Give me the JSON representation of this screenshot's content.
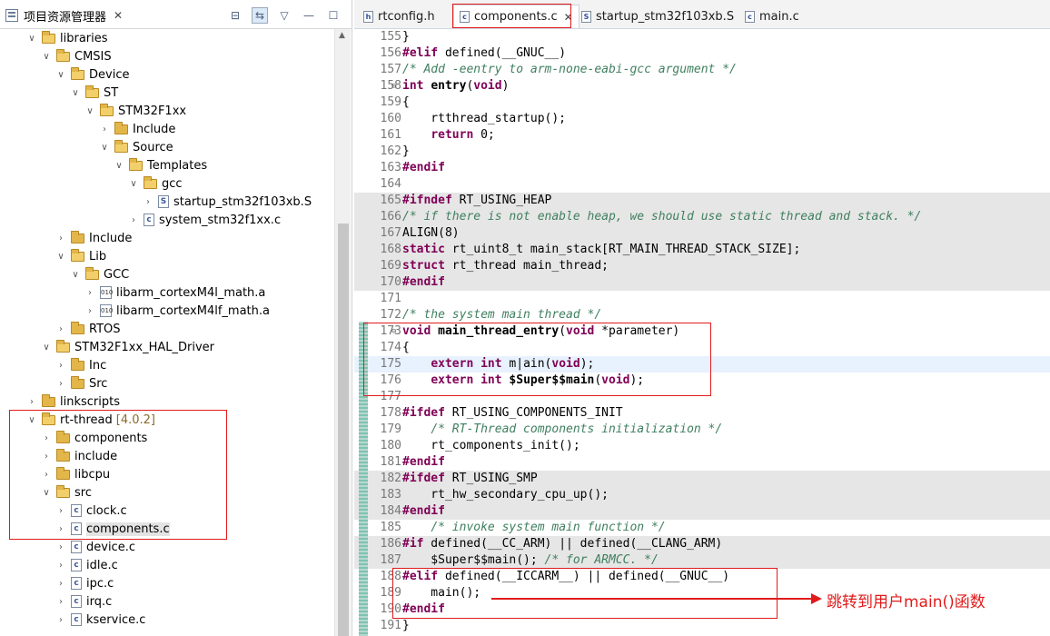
{
  "explorer": {
    "title": "项目资源管理器",
    "close_glyph": "✕",
    "tools": {
      "collapse": "⊟",
      "link": "⇆",
      "menu": "▽",
      "minimize": "—",
      "maximize": "☐"
    },
    "tree": [
      {
        "label": "libraries",
        "depth": 2,
        "type": "folder",
        "open": true
      },
      {
        "label": "CMSIS",
        "depth": 3,
        "type": "folder",
        "open": true
      },
      {
        "label": "Device",
        "depth": 4,
        "type": "folder",
        "open": true
      },
      {
        "label": "ST",
        "depth": 5,
        "type": "folder",
        "open": true
      },
      {
        "label": "STM32F1xx",
        "depth": 6,
        "type": "folder",
        "open": true
      },
      {
        "label": "Include",
        "depth": 7,
        "type": "folder",
        "open": false
      },
      {
        "label": "Source",
        "depth": 7,
        "type": "folder",
        "open": true
      },
      {
        "label": "Templates",
        "depth": 8,
        "type": "folder",
        "open": true
      },
      {
        "label": "gcc",
        "depth": 9,
        "type": "folder",
        "open": true
      },
      {
        "label": "startup_stm32f103xb.S",
        "depth": 10,
        "type": "s-file",
        "open": false
      },
      {
        "label": "system_stm32f1xx.c",
        "depth": 9,
        "type": "c-file",
        "open": false
      },
      {
        "label": "Include",
        "depth": 4,
        "type": "folder",
        "open": false
      },
      {
        "label": "Lib",
        "depth": 4,
        "type": "folder",
        "open": true
      },
      {
        "label": "GCC",
        "depth": 5,
        "type": "folder",
        "open": true
      },
      {
        "label": "libarm_cortexM4l_math.a",
        "depth": 6,
        "type": "lib-file",
        "open": false
      },
      {
        "label": "libarm_cortexM4lf_math.a",
        "depth": 6,
        "type": "lib-file",
        "open": false
      },
      {
        "label": "RTOS",
        "depth": 4,
        "type": "folder",
        "open": false
      },
      {
        "label": "STM32F1xx_HAL_Driver",
        "depth": 3,
        "type": "folder",
        "open": true
      },
      {
        "label": "Inc",
        "depth": 4,
        "type": "folder",
        "open": false
      },
      {
        "label": "Src",
        "depth": 4,
        "type": "folder",
        "open": false
      },
      {
        "label": "linkscripts",
        "depth": 2,
        "type": "folder",
        "open": false
      },
      {
        "label": "rt-thread",
        "version": "[4.0.2]",
        "depth": 2,
        "type": "folder",
        "open": true
      },
      {
        "label": "components",
        "depth": 3,
        "type": "folder",
        "open": false
      },
      {
        "label": "include",
        "depth": 3,
        "type": "folder",
        "open": false
      },
      {
        "label": "libcpu",
        "depth": 3,
        "type": "folder",
        "open": false
      },
      {
        "label": "src",
        "depth": 3,
        "type": "folder",
        "open": true
      },
      {
        "label": "clock.c",
        "depth": 4,
        "type": "c-file",
        "open": false
      },
      {
        "label": "components.c",
        "depth": 4,
        "type": "c-file",
        "open": false,
        "selected": true
      },
      {
        "label": "device.c",
        "depth": 4,
        "type": "c-file",
        "open": false
      },
      {
        "label": "idle.c",
        "depth": 4,
        "type": "c-file",
        "open": false
      },
      {
        "label": "ipc.c",
        "depth": 4,
        "type": "c-file",
        "open": false
      },
      {
        "label": "irq.c",
        "depth": 4,
        "type": "c-file",
        "open": false
      },
      {
        "label": "kservice.c",
        "depth": 4,
        "type": "c-file",
        "open": false
      }
    ]
  },
  "editor": {
    "tabs": [
      {
        "label": "rtconfig.h",
        "icon": "h",
        "active": false
      },
      {
        "label": "components.c",
        "icon": "c",
        "active": true,
        "close": "✕"
      },
      {
        "label": "startup_stm32f103xb.S",
        "icon": "S",
        "active": false
      },
      {
        "label": "main.c",
        "icon": "c",
        "active": false
      }
    ],
    "lines": [
      {
        "n": "155",
        "bg": "",
        "parts": [
          [
            "}",
            ""
          ]
        ]
      },
      {
        "n": "156",
        "bg": "",
        "parts": [
          [
            "#elif",
            "kw"
          ],
          [
            " defined(__GNUC__)",
            ""
          ]
        ]
      },
      {
        "n": "157",
        "bg": "",
        "parts": [
          [
            "/* Add -eentry to arm-none-eabi-gcc argument */",
            "cm"
          ]
        ]
      },
      {
        "n": "158",
        "bg": "",
        "fold": "⊖",
        "parts": [
          [
            "int",
            "kw"
          ],
          [
            " ",
            ""
          ],
          [
            "entry",
            "fn"
          ],
          [
            "(",
            ""
          ],
          [
            "void",
            "kw"
          ],
          [
            ")",
            ""
          ]
        ]
      },
      {
        "n": "159",
        "bg": "",
        "parts": [
          [
            "{",
            ""
          ]
        ]
      },
      {
        "n": "160",
        "bg": "",
        "parts": [
          [
            "    rtthread_startup();",
            ""
          ]
        ]
      },
      {
        "n": "161",
        "bg": "",
        "parts": [
          [
            "    ",
            ""
          ],
          [
            "return",
            "kw"
          ],
          [
            " 0;",
            ""
          ]
        ]
      },
      {
        "n": "162",
        "bg": "",
        "parts": [
          [
            "}",
            ""
          ]
        ]
      },
      {
        "n": "163",
        "bg": "",
        "parts": [
          [
            "#endif",
            "kw"
          ]
        ]
      },
      {
        "n": "164",
        "bg": "",
        "parts": [
          [
            "",
            ""
          ]
        ]
      },
      {
        "n": "165",
        "bg": "hl",
        "parts": [
          [
            "#ifndef",
            "kw"
          ],
          [
            " RT_USING_HEAP",
            ""
          ]
        ]
      },
      {
        "n": "166",
        "bg": "hl",
        "parts": [
          [
            "/* if there is not enable heap, we should use static thread and stack. */",
            "cm"
          ]
        ]
      },
      {
        "n": "167",
        "bg": "hl",
        "parts": [
          [
            "ALIGN(8)",
            ""
          ]
        ]
      },
      {
        "n": "168",
        "bg": "hl",
        "parts": [
          [
            "static",
            "kw"
          ],
          [
            " rt_uint8_t main_stack[RT_MAIN_THREAD_STACK_SIZE];",
            ""
          ]
        ]
      },
      {
        "n": "169",
        "bg": "hl",
        "parts": [
          [
            "struct",
            "kw"
          ],
          [
            " rt_thread main_thread;",
            ""
          ]
        ]
      },
      {
        "n": "170",
        "bg": "hl",
        "parts": [
          [
            "#endif",
            "kw"
          ]
        ]
      },
      {
        "n": "171",
        "bg": "",
        "parts": [
          [
            "",
            ""
          ]
        ]
      },
      {
        "n": "172",
        "bg": "",
        "parts": [
          [
            "/* the system main thread */",
            "cm"
          ]
        ]
      },
      {
        "n": "173",
        "bg": "",
        "fold": "⊖",
        "parts": [
          [
            "void",
            "kw"
          ],
          [
            " ",
            ""
          ],
          [
            "main_thread_entry",
            "fn"
          ],
          [
            "(",
            ""
          ],
          [
            "void",
            "kw"
          ],
          [
            " *parameter)",
            ""
          ]
        ]
      },
      {
        "n": "174",
        "bg": "",
        "parts": [
          [
            "{",
            ""
          ]
        ]
      },
      {
        "n": "175",
        "bg": "cur",
        "parts": [
          [
            "    ",
            ""
          ],
          [
            "extern",
            "kw"
          ],
          [
            " ",
            ""
          ],
          [
            "int",
            "kw"
          ],
          [
            " m",
            ""
          ],
          [
            "|",
            ""
          ],
          [
            "ain(",
            ""
          ],
          [
            "void",
            "kw"
          ],
          [
            ");",
            ""
          ]
        ]
      },
      {
        "n": "176",
        "bg": "",
        "parts": [
          [
            "    ",
            ""
          ],
          [
            "extern",
            "kw"
          ],
          [
            " ",
            ""
          ],
          [
            "int",
            "kw"
          ],
          [
            " ",
            ""
          ],
          [
            "$Super$$main",
            "fn"
          ],
          [
            "(",
            ""
          ],
          [
            "void",
            "kw"
          ],
          [
            ");",
            ""
          ]
        ]
      },
      {
        "n": "177",
        "bg": "",
        "parts": [
          [
            "",
            ""
          ]
        ]
      },
      {
        "n": "178",
        "bg": "",
        "parts": [
          [
            "#ifdef",
            "kw"
          ],
          [
            " RT_USING_COMPONENTS_INIT",
            ""
          ]
        ]
      },
      {
        "n": "179",
        "bg": "",
        "parts": [
          [
            "    ",
            ""
          ],
          [
            "/* RT-Thread components initialization */",
            "cm"
          ]
        ]
      },
      {
        "n": "180",
        "bg": "",
        "parts": [
          [
            "    rt_components_init();",
            ""
          ]
        ]
      },
      {
        "n": "181",
        "bg": "",
        "parts": [
          [
            "#endif",
            "kw"
          ]
        ]
      },
      {
        "n": "182",
        "bg": "hl",
        "parts": [
          [
            "#ifdef",
            "kw"
          ],
          [
            " RT_USING_SMP",
            ""
          ]
        ]
      },
      {
        "n": "183",
        "bg": "hl",
        "parts": [
          [
            "    rt_hw_secondary_cpu_up();",
            ""
          ]
        ]
      },
      {
        "n": "184",
        "bg": "hl",
        "parts": [
          [
            "#endif",
            "kw"
          ]
        ]
      },
      {
        "n": "185",
        "bg": "",
        "parts": [
          [
            "    ",
            ""
          ],
          [
            "/* invoke system main function */",
            "cm"
          ]
        ]
      },
      {
        "n": "186",
        "bg": "hl",
        "parts": [
          [
            "#if",
            "kw"
          ],
          [
            " defined(__CC_ARM) || defined(__CLANG_ARM)",
            ""
          ]
        ]
      },
      {
        "n": "187",
        "bg": "hl",
        "parts": [
          [
            "    $Super$$main(); ",
            ""
          ],
          [
            "/* for ARMCC. */",
            "cm"
          ]
        ]
      },
      {
        "n": "188",
        "bg": "",
        "parts": [
          [
            "#elif",
            "kw"
          ],
          [
            " defined(__ICCARM__) || defined(__GNUC__)",
            ""
          ]
        ]
      },
      {
        "n": "189",
        "bg": "",
        "parts": [
          [
            "    main();",
            ""
          ]
        ]
      },
      {
        "n": "190",
        "bg": "",
        "parts": [
          [
            "#endif",
            "kw"
          ]
        ]
      },
      {
        "n": "191",
        "bg": "",
        "parts": [
          [
            "}",
            ""
          ]
        ]
      }
    ]
  },
  "annotation": {
    "text": "跳转到用户main()函数",
    "color": "#e11b1b"
  }
}
